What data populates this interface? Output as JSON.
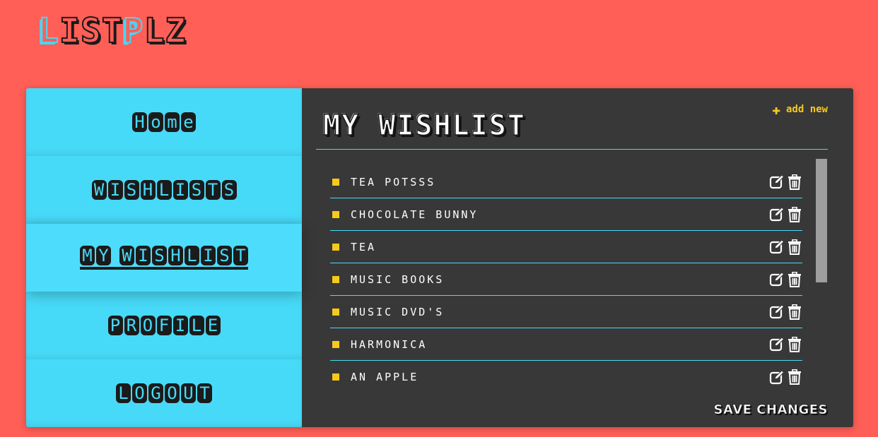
{
  "logo": {
    "letters": [
      {
        "ch": "L",
        "accent": true
      },
      {
        "ch": "I",
        "accent": false
      },
      {
        "ch": "S",
        "accent": false
      },
      {
        "ch": "T",
        "accent": false
      },
      {
        "ch": "P",
        "accent": true
      },
      {
        "ch": "L",
        "accent": false
      },
      {
        "ch": "Z",
        "accent": false
      }
    ]
  },
  "colors": {
    "background": "#ff5f57",
    "sidebar": "#47daf8",
    "panel": "#383838",
    "accent_yellow": "#f7c91c",
    "divider": "#47daf8"
  },
  "nav": {
    "items": [
      {
        "label": "Home",
        "active": false
      },
      {
        "label": "WISHLISTS",
        "active": false
      },
      {
        "label": "MY WISHLIST",
        "active": true
      },
      {
        "label": "PROFILE",
        "active": false
      },
      {
        "label": "LOGOUT",
        "active": false
      }
    ]
  },
  "main": {
    "title": "MY WISHLIST",
    "add_new_label": "add new",
    "add_new_icon": "plus-icon",
    "items": [
      {
        "label": "TEA POTSSS"
      },
      {
        "label": "CHOCOLATE BUNNY"
      },
      {
        "label": "TEA"
      },
      {
        "label": "MUSIC BOOKS"
      },
      {
        "label": "MUSIC DVD'S"
      },
      {
        "label": "HARMONICA"
      },
      {
        "label": "AN APPLE"
      }
    ],
    "item_icons": [
      "edit-icon",
      "trash-icon"
    ],
    "save_label": "SAVE CHANGES"
  }
}
